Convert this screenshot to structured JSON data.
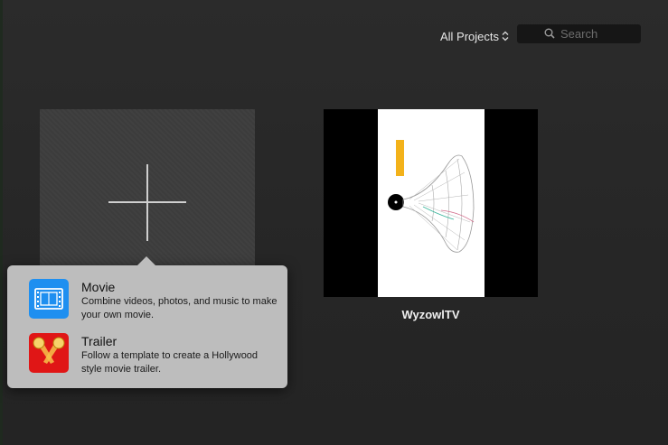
{
  "toolbar": {
    "filter_label": "All Projects",
    "search_placeholder": "Search"
  },
  "new_project": {
    "menu": {
      "items": [
        {
          "title": "Movie",
          "description": "Combine videos, photos, and music to make your own movie.",
          "icon": "movie-film-icon"
        },
        {
          "title": "Trailer",
          "description": "Follow a template to create a Hollywood style movie trailer.",
          "icon": "trailer-spotlights-icon"
        }
      ]
    }
  },
  "projects": [
    {
      "title": "WyzowlTV"
    }
  ],
  "colors": {
    "background": "#262626",
    "popover": "#bdbdbd",
    "movie_blue": "#1e8ff0",
    "trailer_red": "#e01616"
  }
}
